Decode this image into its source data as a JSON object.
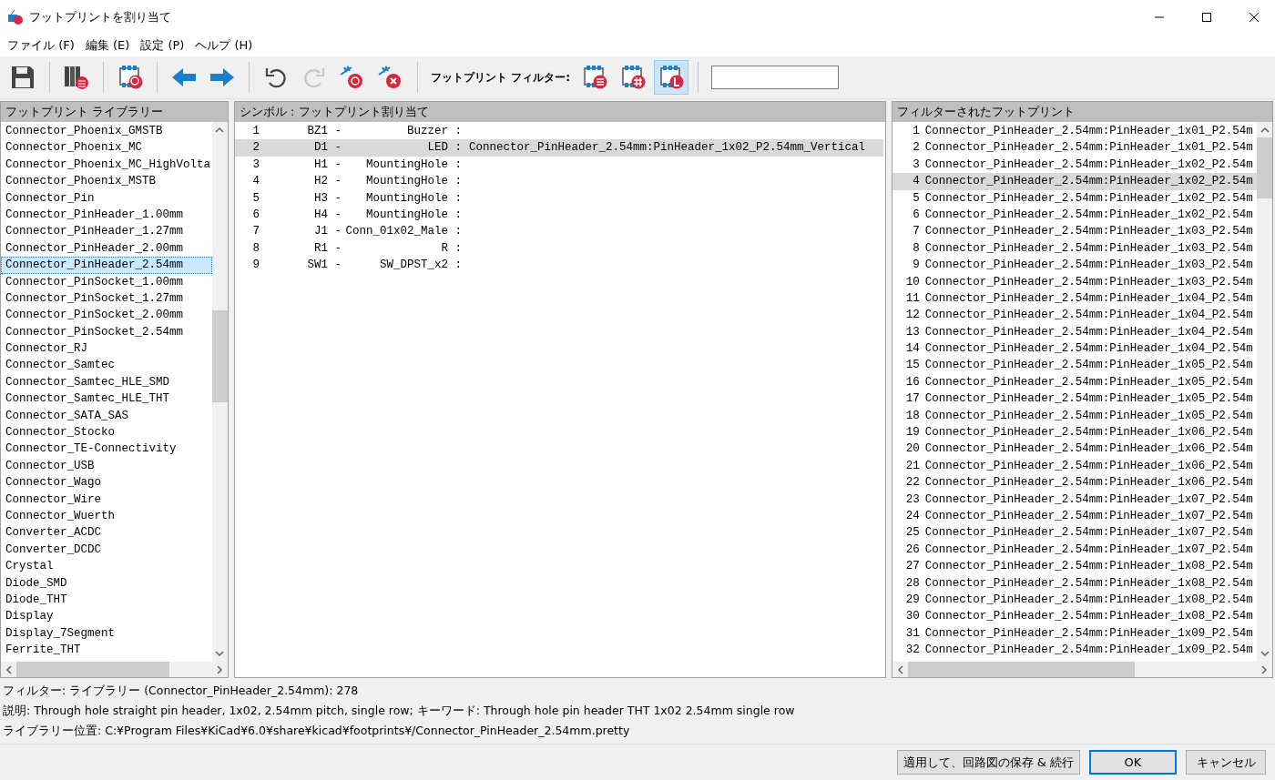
{
  "window": {
    "title": "フットプリントを割り当て"
  },
  "menu": [
    "ファイル (F)",
    "編集 (E)",
    "設定 (P)",
    "ヘルプ (H)"
  ],
  "toolbar": {
    "filter_label": "フットプリント フィルター:",
    "redo_disabled": true,
    "filters": [
      {
        "kind": "keywords",
        "selected": false
      },
      {
        "kind": "pincount",
        "selected": false
      },
      {
        "kind": "library",
        "selected": true
      }
    ]
  },
  "libraries": {
    "title": "フットプリント ライブラリー",
    "items": [
      {
        "name": "Connector_Phoenix_GMSTB",
        "selected": false
      },
      {
        "name": "Connector_Phoenix_MC",
        "selected": false
      },
      {
        "name": "Connector_Phoenix_MC_HighVolta",
        "selected": false
      },
      {
        "name": "Connector_Phoenix_MSTB",
        "selected": false
      },
      {
        "name": "Connector_Pin",
        "selected": false
      },
      {
        "name": "Connector_PinHeader_1.00mm",
        "selected": false
      },
      {
        "name": "Connector_PinHeader_1.27mm",
        "selected": false
      },
      {
        "name": "Connector_PinHeader_2.00mm",
        "selected": false
      },
      {
        "name": "Connector_PinHeader_2.54mm",
        "selected": true
      },
      {
        "name": "Connector_PinSocket_1.00mm",
        "selected": false
      },
      {
        "name": "Connector_PinSocket_1.27mm",
        "selected": false
      },
      {
        "name": "Connector_PinSocket_2.00mm",
        "selected": false
      },
      {
        "name": "Connector_PinSocket_2.54mm",
        "selected": false
      },
      {
        "name": "Connector_RJ",
        "selected": false
      },
      {
        "name": "Connector_Samtec",
        "selected": false
      },
      {
        "name": "Connector_Samtec_HLE_SMD",
        "selected": false
      },
      {
        "name": "Connector_Samtec_HLE_THT",
        "selected": false
      },
      {
        "name": "Connector_SATA_SAS",
        "selected": false
      },
      {
        "name": "Connector_Stocko",
        "selected": false
      },
      {
        "name": "Connector_TE-Connectivity",
        "selected": false
      },
      {
        "name": "Connector_USB",
        "selected": false
      },
      {
        "name": "Connector_Wago",
        "selected": false
      },
      {
        "name": "Connector_Wire",
        "selected": false
      },
      {
        "name": "Connector_Wuerth",
        "selected": false
      },
      {
        "name": "Converter_ACDC",
        "selected": false
      },
      {
        "name": "Converter_DCDC",
        "selected": false
      },
      {
        "name": "Crystal",
        "selected": false
      },
      {
        "name": "Diode_SMD",
        "selected": false
      },
      {
        "name": "Diode_THT",
        "selected": false
      },
      {
        "name": "Display",
        "selected": false
      },
      {
        "name": "Display_7Segment",
        "selected": false
      },
      {
        "name": "Ferrite_THT",
        "selected": false
      }
    ]
  },
  "symbols": {
    "title": "シンボル : フットプリント割り当て",
    "rows": [
      {
        "number": "1",
        "reference": "BZ1 -",
        "value": "Buzzer :",
        "selected": false
      },
      {
        "number": "2",
        "reference": "D1 -",
        "value": "LED :",
        "footprint": "Connector_PinHeader_2.54mm:PinHeader_1x02_P2.54mm_Vertical",
        "selected": true
      },
      {
        "number": "3",
        "reference": "H1 -",
        "value": "MountingHole :",
        "selected": false
      },
      {
        "number": "4",
        "reference": "H2 -",
        "value": "MountingHole :",
        "selected": false
      },
      {
        "number": "5",
        "reference": "H3 -",
        "value": "MountingHole :",
        "selected": false
      },
      {
        "number": "6",
        "reference": "H4 -",
        "value": "MountingHole :",
        "selected": false
      },
      {
        "number": "7",
        "reference": "J1 -",
        "value": "Conn_01x02_Male :",
        "selected": false
      },
      {
        "number": "8",
        "reference": "R1 -",
        "value": "R :",
        "selected": false
      },
      {
        "number": "9",
        "reference": "SW1 -",
        "value": "SW_DPST_x2 :",
        "selected": false
      }
    ]
  },
  "footprints": {
    "title": "フィルターされたフットプリント",
    "items": [
      {
        "number": "1",
        "name": "Connector_PinHeader_2.54mm:PinHeader_1x01_P2.54m",
        "selected": false
      },
      {
        "number": "2",
        "name": "Connector_PinHeader_2.54mm:PinHeader_1x01_P2.54m",
        "selected": false
      },
      {
        "number": "3",
        "name": "Connector_PinHeader_2.54mm:PinHeader_1x02_P2.54m",
        "selected": false
      },
      {
        "number": "4",
        "name": "Connector_PinHeader_2.54mm:PinHeader_1x02_P2.54m",
        "selected": true
      },
      {
        "number": "5",
        "name": "Connector_PinHeader_2.54mm:PinHeader_1x02_P2.54m",
        "selected": false
      },
      {
        "number": "6",
        "name": "Connector_PinHeader_2.54mm:PinHeader_1x02_P2.54m",
        "selected": false
      },
      {
        "number": "7",
        "name": "Connector_PinHeader_2.54mm:PinHeader_1x03_P2.54m",
        "selected": false
      },
      {
        "number": "8",
        "name": "Connector_PinHeader_2.54mm:PinHeader_1x03_P2.54m",
        "selected": false
      },
      {
        "number": "9",
        "name": "Connector_PinHeader_2.54mm:PinHeader_1x03_P2.54m",
        "selected": false
      },
      {
        "number": "10",
        "name": "Connector_PinHeader_2.54mm:PinHeader_1x03_P2.54m",
        "selected": false
      },
      {
        "number": "11",
        "name": "Connector_PinHeader_2.54mm:PinHeader_1x04_P2.54m",
        "selected": false
      },
      {
        "number": "12",
        "name": "Connector_PinHeader_2.54mm:PinHeader_1x04_P2.54m",
        "selected": false
      },
      {
        "number": "13",
        "name": "Connector_PinHeader_2.54mm:PinHeader_1x04_P2.54m",
        "selected": false
      },
      {
        "number": "14",
        "name": "Connector_PinHeader_2.54mm:PinHeader_1x04_P2.54m",
        "selected": false
      },
      {
        "number": "15",
        "name": "Connector_PinHeader_2.54mm:PinHeader_1x05_P2.54m",
        "selected": false
      },
      {
        "number": "16",
        "name": "Connector_PinHeader_2.54mm:PinHeader_1x05_P2.54m",
        "selected": false
      },
      {
        "number": "17",
        "name": "Connector_PinHeader_2.54mm:PinHeader_1x05_P2.54m",
        "selected": false
      },
      {
        "number": "18",
        "name": "Connector_PinHeader_2.54mm:PinHeader_1x05_P2.54m",
        "selected": false
      },
      {
        "number": "19",
        "name": "Connector_PinHeader_2.54mm:PinHeader_1x06_P2.54m",
        "selected": false
      },
      {
        "number": "20",
        "name": "Connector_PinHeader_2.54mm:PinHeader_1x06_P2.54m",
        "selected": false
      },
      {
        "number": "21",
        "name": "Connector_PinHeader_2.54mm:PinHeader_1x06_P2.54m",
        "selected": false
      },
      {
        "number": "22",
        "name": "Connector_PinHeader_2.54mm:PinHeader_1x06_P2.54m",
        "selected": false
      },
      {
        "number": "23",
        "name": "Connector_PinHeader_2.54mm:PinHeader_1x07_P2.54m",
        "selected": false
      },
      {
        "number": "24",
        "name": "Connector_PinHeader_2.54mm:PinHeader_1x07_P2.54m",
        "selected": false
      },
      {
        "number": "25",
        "name": "Connector_PinHeader_2.54mm:PinHeader_1x07_P2.54m",
        "selected": false
      },
      {
        "number": "26",
        "name": "Connector_PinHeader_2.54mm:PinHeader_1x07_P2.54m",
        "selected": false
      },
      {
        "number": "27",
        "name": "Connector_PinHeader_2.54mm:PinHeader_1x08_P2.54m",
        "selected": false
      },
      {
        "number": "28",
        "name": "Connector_PinHeader_2.54mm:PinHeader_1x08_P2.54m",
        "selected": false
      },
      {
        "number": "29",
        "name": "Connector_PinHeader_2.54mm:PinHeader_1x08_P2.54m",
        "selected": false
      },
      {
        "number": "30",
        "name": "Connector_PinHeader_2.54mm:PinHeader_1x08_P2.54m",
        "selected": false
      },
      {
        "number": "31",
        "name": "Connector_PinHeader_2.54mm:PinHeader_1x09_P2.54m",
        "selected": false
      },
      {
        "number": "32",
        "name": "Connector_PinHeader_2.54mm:PinHeader_1x09_P2.54m",
        "selected": false
      }
    ]
  },
  "status": [
    "フィルター: ライブラリー (Connector_PinHeader_2.54mm): 278",
    "説明: Through hole straight pin header, 1x02, 2.54mm pitch, single row;  キーワード: Through hole pin header THT 1x02 2.54mm single row",
    "ライブラリー位置: C:¥Program Files¥KiCad¥6.0¥share¥kicad¥footprints¥/Connector_PinHeader_2.54mm.pretty"
  ],
  "buttons": [
    {
      "label": "適用して、回路図の保存 & 続行",
      "kind": "normal"
    },
    {
      "label": "OK",
      "kind": "default"
    },
    {
      "label": "キャンセル",
      "kind": "normal"
    }
  ]
}
